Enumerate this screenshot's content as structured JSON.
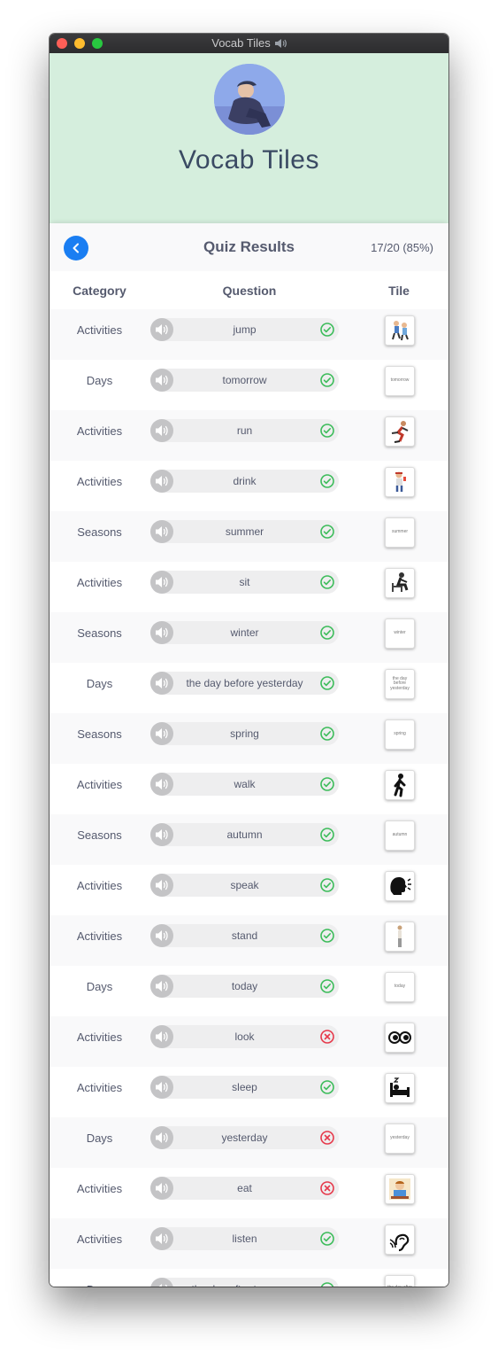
{
  "window": {
    "title": "Vocab Tiles"
  },
  "header": {
    "app_name": "Vocab Tiles"
  },
  "results": {
    "title": "Quiz Results",
    "score": "17/20 (85%)",
    "columns": {
      "category": "Category",
      "question": "Question",
      "tile": "Tile"
    },
    "rows": [
      {
        "category": "Activities",
        "question": "jump",
        "result": "correct",
        "tile_icon": "jump-icon",
        "tile_text": ""
      },
      {
        "category": "Days",
        "question": "tomorrow",
        "result": "correct",
        "tile_icon": "",
        "tile_text": "tomorrow"
      },
      {
        "category": "Activities",
        "question": "run",
        "result": "correct",
        "tile_icon": "run-icon",
        "tile_text": ""
      },
      {
        "category": "Activities",
        "question": "drink",
        "result": "correct",
        "tile_icon": "drink-icon",
        "tile_text": ""
      },
      {
        "category": "Seasons",
        "question": "summer",
        "result": "correct",
        "tile_icon": "",
        "tile_text": "summer"
      },
      {
        "category": "Activities",
        "question": "sit",
        "result": "correct",
        "tile_icon": "sit-icon",
        "tile_text": ""
      },
      {
        "category": "Seasons",
        "question": "winter",
        "result": "correct",
        "tile_icon": "",
        "tile_text": "winter"
      },
      {
        "category": "Days",
        "question": "the day before yesterday",
        "result": "correct",
        "tile_icon": "",
        "tile_text": "the day before yesterday"
      },
      {
        "category": "Seasons",
        "question": "spring",
        "result": "correct",
        "tile_icon": "",
        "tile_text": "spring"
      },
      {
        "category": "Activities",
        "question": "walk",
        "result": "correct",
        "tile_icon": "walk-icon",
        "tile_text": ""
      },
      {
        "category": "Seasons",
        "question": "autumn",
        "result": "correct",
        "tile_icon": "",
        "tile_text": "autumn"
      },
      {
        "category": "Activities",
        "question": "speak",
        "result": "correct",
        "tile_icon": "speak-icon",
        "tile_text": ""
      },
      {
        "category": "Activities",
        "question": "stand",
        "result": "correct",
        "tile_icon": "stand-icon",
        "tile_text": ""
      },
      {
        "category": "Days",
        "question": "today",
        "result": "correct",
        "tile_icon": "",
        "tile_text": "today"
      },
      {
        "category": "Activities",
        "question": "look",
        "result": "incorrect",
        "tile_icon": "look-icon",
        "tile_text": ""
      },
      {
        "category": "Activities",
        "question": "sleep",
        "result": "correct",
        "tile_icon": "sleep-icon",
        "tile_text": ""
      },
      {
        "category": "Days",
        "question": "yesterday",
        "result": "incorrect",
        "tile_icon": "",
        "tile_text": "yesterday"
      },
      {
        "category": "Activities",
        "question": "eat",
        "result": "incorrect",
        "tile_icon": "eat-icon",
        "tile_text": ""
      },
      {
        "category": "Activities",
        "question": "listen",
        "result": "correct",
        "tile_icon": "listen-icon",
        "tile_text": ""
      },
      {
        "category": "Days",
        "question": "the day after tomorrow",
        "result": "correct",
        "tile_icon": "",
        "tile_text": "the day after tomorrow"
      }
    ]
  },
  "colors": {
    "header_bg": "#d5eedd",
    "accent": "#1a7ef2",
    "correct": "#3cbc5a",
    "incorrect": "#e6394b",
    "text": "#555a6e"
  }
}
